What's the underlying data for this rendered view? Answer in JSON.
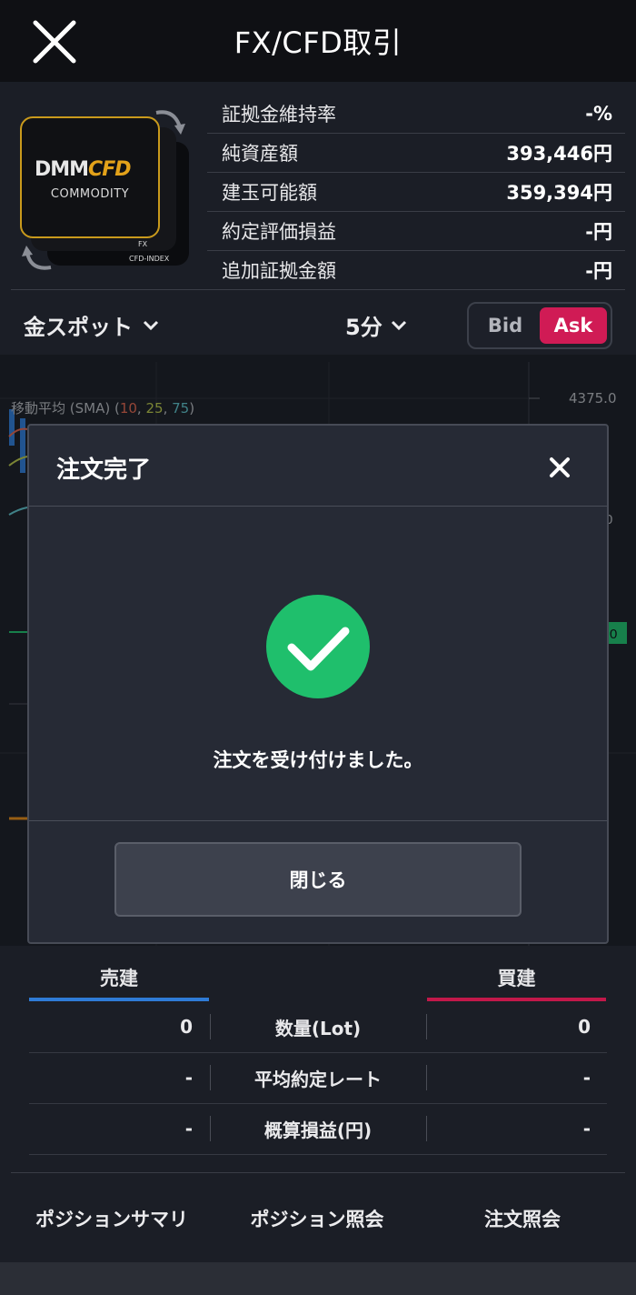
{
  "header": {
    "title": "FX/CFD取引"
  },
  "logo": {
    "brand": "DMM",
    "brand_accent": "CFD",
    "sub": "COMMODITY",
    "tag_fx": "FX",
    "tag_index": "CFD-INDEX"
  },
  "account": {
    "rows": [
      {
        "label": "証拠金維持率",
        "value": "-%"
      },
      {
        "label": "純資産額",
        "value": "393,446円"
      },
      {
        "label": "建玉可能額",
        "value": "359,394円"
      },
      {
        "label": "約定評価損益",
        "value": "-円"
      },
      {
        "label": "追加証拠金額",
        "value": "-円"
      }
    ]
  },
  "toolbar": {
    "instrument": "金スポット",
    "timeframe": "5分",
    "bid": "Bid",
    "ask": "Ask",
    "selected": "Ask"
  },
  "chart": {
    "sma_label": "移動平均 (SMA) (",
    "sma_10": "10",
    "sma_25": "25",
    "sma_75": "75",
    "sma_close": ")",
    "price_top": "4375.0",
    "price_mid": "0",
    "price_tag": "0",
    "colors": {
      "sma10": "#e0664e",
      "sma25": "#b8c64a",
      "sma75": "#5fc2c9",
      "tag": "#1fbf6c",
      "orange": "#e38a18"
    }
  },
  "modal": {
    "title": "注文完了",
    "message": "注文を受け付けました。",
    "close_button": "閉じる"
  },
  "positions": {
    "sell_header": "売建",
    "buy_header": "買建",
    "rows": [
      {
        "sell": "0",
        "label": "数量(Lot)",
        "buy": "0"
      },
      {
        "sell": "-",
        "label": "平均約定レート",
        "buy": "-"
      },
      {
        "sell": "-",
        "label": "概算損益(円)",
        "buy": "-"
      }
    ]
  },
  "bottom_nav": {
    "summary": "ポジションサマリ",
    "inquiry": "ポジション照会",
    "orders": "注文照会"
  }
}
